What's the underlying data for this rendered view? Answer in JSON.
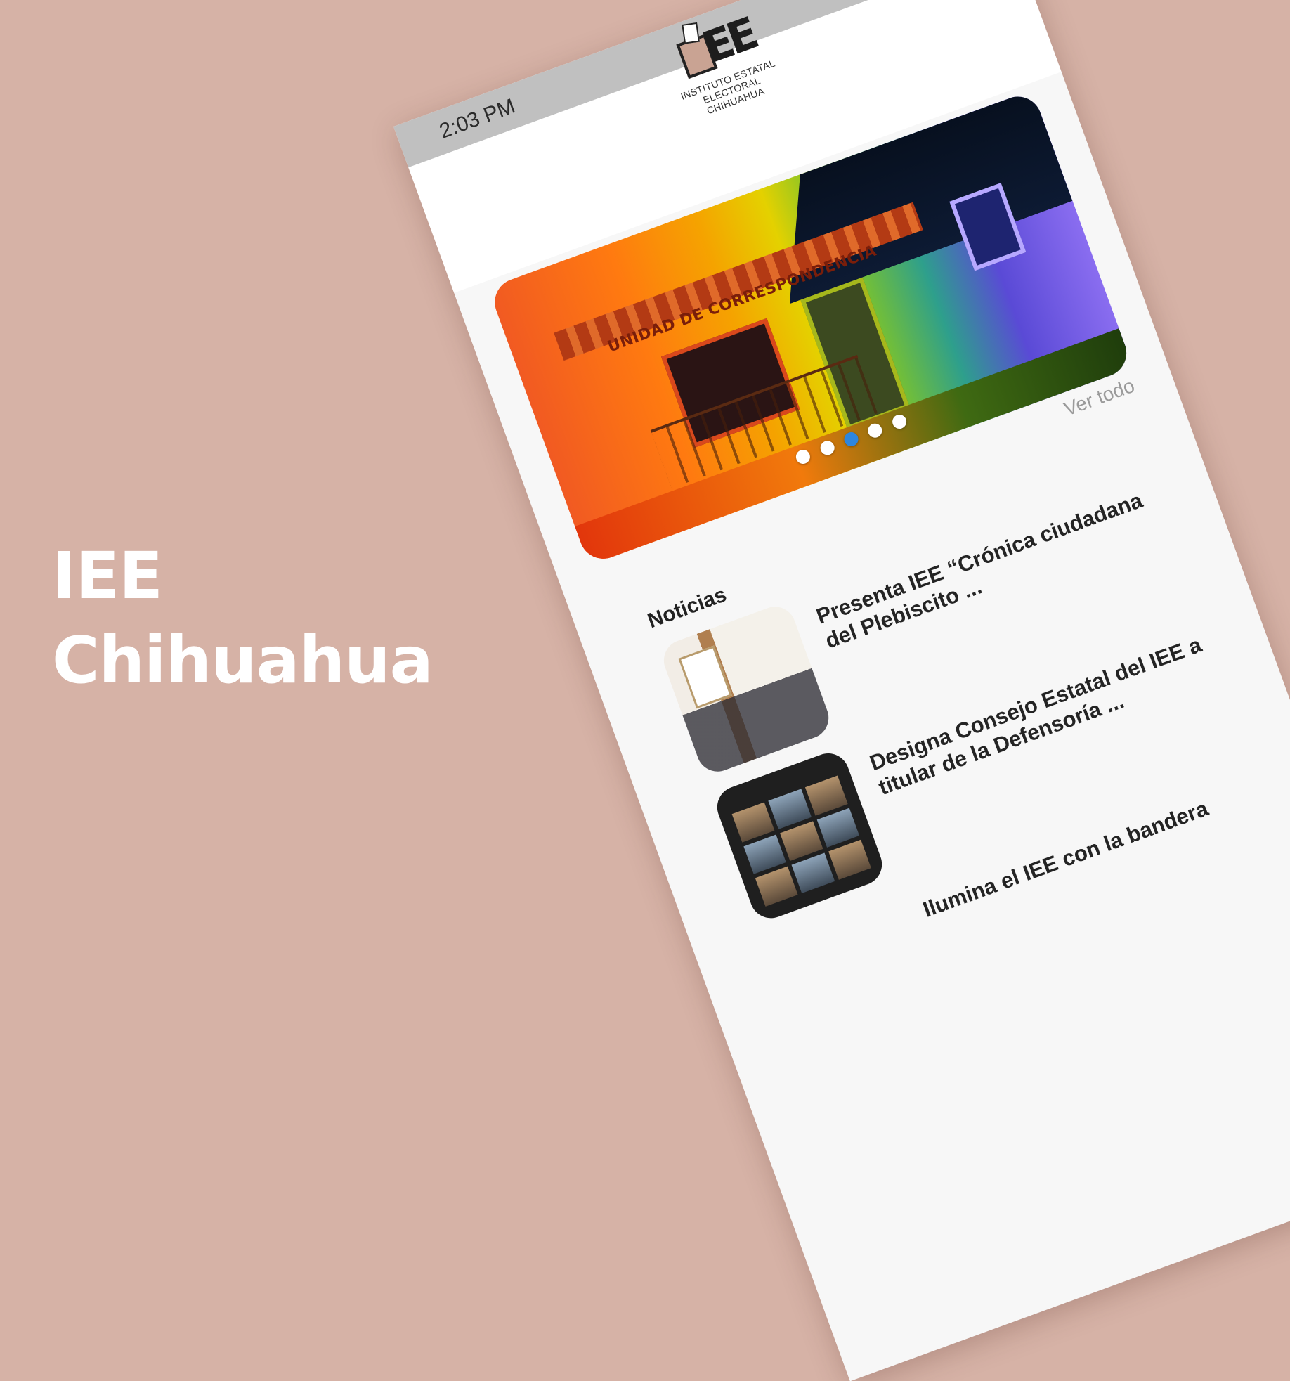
{
  "promo": {
    "title_line1": "IEE",
    "title_line2": "Chihuahua"
  },
  "status_bar": {
    "time": "2:03 PM"
  },
  "header": {
    "logo_line1": "INSTITUTO ESTATAL ELECTORAL",
    "logo_line2": "CHIHUAHUA"
  },
  "carousel": {
    "sign_text": "UNIDAD DE CORRESPONDENCIA",
    "slide_count": 5,
    "active_index": 2,
    "active_color": "#2e86de"
  },
  "see_all": "Ver todo",
  "news_section": {
    "title": "Noticias",
    "items": [
      {
        "title": "Presenta IEE “Crónica ciudadana del Plebiscito ..."
      },
      {
        "title": "Designa Consejo Estatal del IEE a titular de la Defensoría ..."
      },
      {
        "title": "Ilumina el IEE con la bandera"
      }
    ]
  },
  "colors": {
    "background": "#d6b2a6",
    "status_bar": "#c0c0c0",
    "screen": "#f7f7f7"
  }
}
